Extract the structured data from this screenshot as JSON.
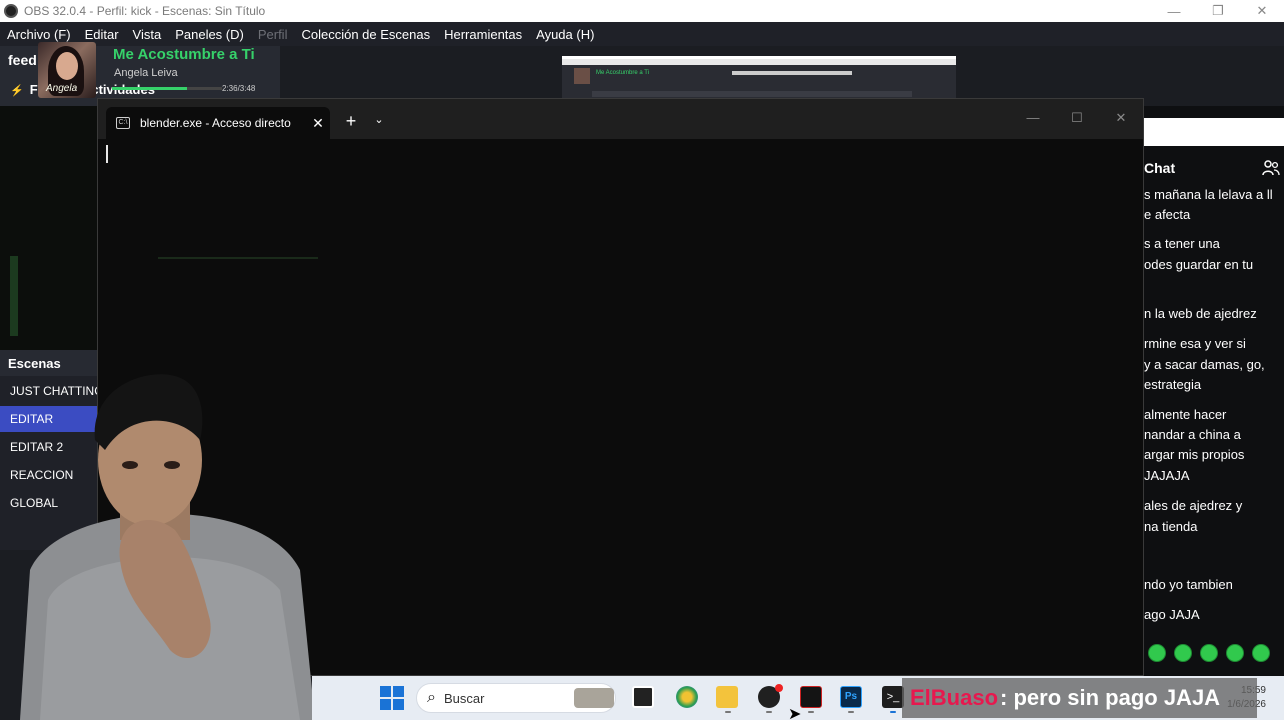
{
  "obs": {
    "title": "OBS 32.0.4 - Perfil: kick - Escenas: Sin Título",
    "menu": [
      "Archivo (F)",
      "Editar",
      "Vista",
      "Paneles (D)",
      "Perfil",
      "Colección de Escenas",
      "Herramientas",
      "Ayuda (H)"
    ],
    "feed_label": "feed",
    "activities_label": "Feed de Actividades",
    "scenes_header": "Escenas",
    "scenes": [
      "JUST CHATTING",
      "EDITAR",
      "EDITAR 2",
      "REACCION",
      "GLOBAL"
    ],
    "active_scene_index": 1
  },
  "music": {
    "title": "Me Acostumbre a Ti",
    "artist": "Angela Leiva",
    "time": "2:36/3:48",
    "progress": 0.68,
    "art_signature": "Angela"
  },
  "terminal": {
    "tab_label": "blender.exe - Acceso directo",
    "new_tab": "+",
    "dropdown": "⌄",
    "close_tab": "✕"
  },
  "chat": {
    "header": "Chat",
    "lines": [
      "s mañana la lelava a ll",
      "e afecta",
      "s a tener una",
      "odes guardar en tu",
      "n la web de ajedrez",
      "rmine esa y ver si",
      "y a sacar damas, go,",
      " estrategia",
      "almente hacer",
      "nandar a china a",
      "argar mis propios",
      "JAJAJA",
      "ales de ajedrez y",
      "na tienda",
      "ndo yo tambien",
      "ago JAJA"
    ]
  },
  "taskbar": {
    "search_placeholder": "Buscar",
    "clock_time": "15:59",
    "clock_date": "1/6/2026",
    "ps_label": "Ps",
    "terminal_glyph": ">_"
  },
  "overlay": {
    "user": "ElBuaso",
    "message": ": pero sin pago JAJA"
  },
  "colors": {
    "accent_green": "#36d16a",
    "scene_active": "#3b4cc2",
    "overlay_user": "#e7184e"
  }
}
